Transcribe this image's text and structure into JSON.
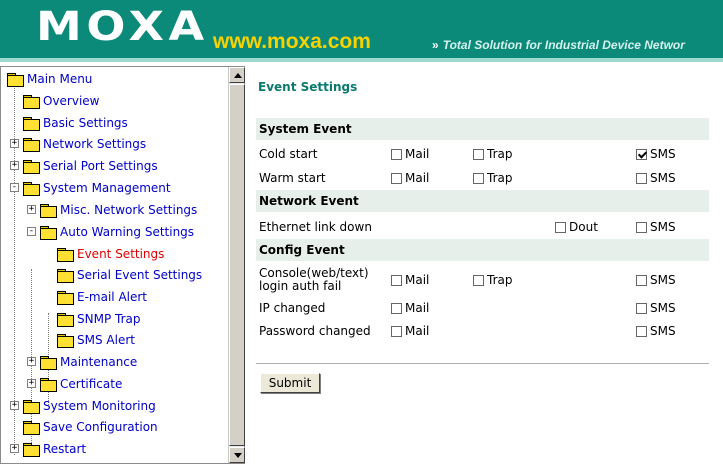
{
  "header": {
    "logo": "MOXA",
    "url": "www.moxa.com",
    "tagline": "Total Solution for Industrial Device Networ",
    "chevron": "»",
    "colors": {
      "header_bg": "#0b8a7a",
      "url": "#f5d200",
      "title": "#0b7a6e",
      "selected": "#e00000",
      "link": "#0000c8"
    }
  },
  "nav": {
    "items": [
      {
        "label": "Main Menu",
        "icon": "open-folder-icon",
        "level": 0,
        "expander": ""
      },
      {
        "label": "Overview",
        "icon": "folder-icon",
        "level": 1,
        "expander": ""
      },
      {
        "label": "Basic Settings",
        "icon": "folder-icon",
        "level": 1,
        "expander": ""
      },
      {
        "label": "Network Settings",
        "icon": "folder-icon",
        "level": 1,
        "expander": "+"
      },
      {
        "label": "Serial Port Settings",
        "icon": "folder-icon",
        "level": 1,
        "expander": "+"
      },
      {
        "label": "System Management",
        "icon": "open-folder-icon",
        "level": 1,
        "expander": "-"
      },
      {
        "label": "Misc. Network Settings",
        "icon": "folder-icon",
        "level": 2,
        "expander": "+"
      },
      {
        "label": "Auto Warning Settings",
        "icon": "open-folder-icon",
        "level": 2,
        "expander": "-"
      },
      {
        "label": "Event Settings",
        "icon": "folder-icon",
        "level": 3,
        "expander": "",
        "selected": true
      },
      {
        "label": "Serial Event Settings",
        "icon": "folder-icon",
        "level": 3,
        "expander": ""
      },
      {
        "label": "E-mail Alert",
        "icon": "folder-icon",
        "level": 3,
        "expander": ""
      },
      {
        "label": "SNMP Trap",
        "icon": "folder-icon",
        "level": 3,
        "expander": ""
      },
      {
        "label": "SMS Alert",
        "icon": "folder-icon",
        "level": 3,
        "expander": ""
      },
      {
        "label": "Maintenance",
        "icon": "folder-icon",
        "level": 2,
        "expander": "+"
      },
      {
        "label": "Certificate",
        "icon": "folder-icon",
        "level": 2,
        "expander": "+"
      },
      {
        "label": "System Monitoring",
        "icon": "folder-icon",
        "level": 1,
        "expander": "+"
      },
      {
        "label": "Save Configuration",
        "icon": "folder-icon",
        "level": 1,
        "expander": ""
      },
      {
        "label": "Restart",
        "icon": "folder-icon",
        "level": 1,
        "expander": "+"
      }
    ]
  },
  "content": {
    "title": "Event Settings",
    "sections": {
      "system": "System Event",
      "network": "Network Event",
      "config": "Config Event"
    },
    "rows": {
      "cold_start": {
        "label": "Cold start",
        "mail": "Mail",
        "trap": "Trap",
        "sms": "SMS",
        "mail_checked": false,
        "trap_checked": false,
        "sms_checked": true
      },
      "warm_start": {
        "label": "Warm start",
        "mail": "Mail",
        "trap": "Trap",
        "sms": "SMS",
        "mail_checked": false,
        "trap_checked": false,
        "sms_checked": false
      },
      "ethernet_down": {
        "label": "Ethernet link down",
        "dout": "Dout",
        "sms": "SMS",
        "dout_checked": false,
        "sms_checked": false
      },
      "console_auth": {
        "label_line1": "Console(web/text)",
        "label_line2": "login auth fail",
        "mail": "Mail",
        "trap": "Trap",
        "sms": "SMS",
        "mail_checked": false,
        "trap_checked": false,
        "sms_checked": false
      },
      "ip_changed": {
        "label": "IP changed",
        "mail": "Mail",
        "sms": "SMS",
        "mail_checked": false,
        "sms_checked": false
      },
      "password_changed": {
        "label": "Password changed",
        "mail": "Mail",
        "sms": "SMS",
        "mail_checked": false,
        "sms_checked": false
      }
    },
    "submit": "Submit"
  }
}
